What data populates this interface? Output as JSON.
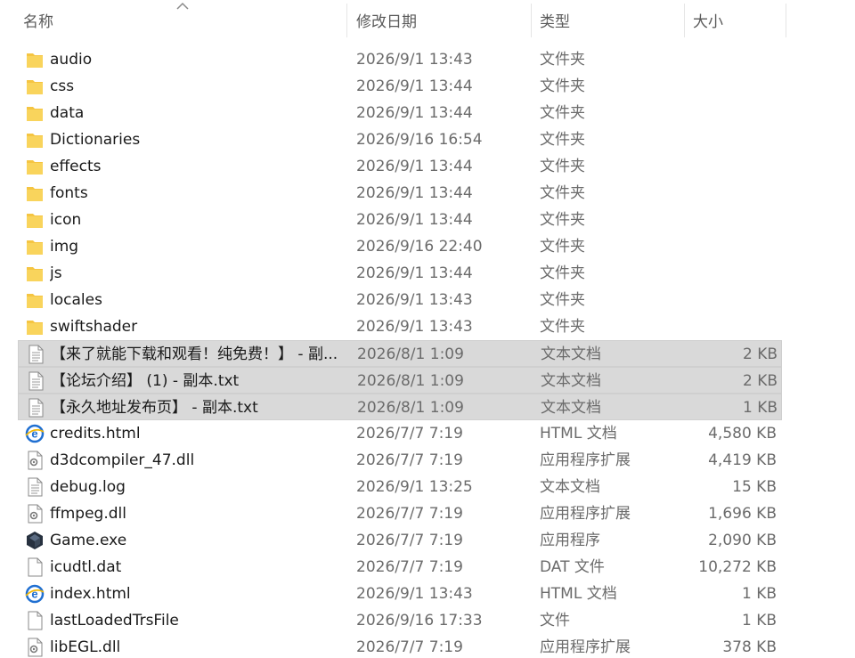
{
  "header": {
    "name": "名称",
    "date": "修改日期",
    "type": "类型",
    "size": "大小"
  },
  "rows": [
    {
      "name": "audio",
      "date": "2026/9/1 13:43",
      "type": "文件夹",
      "size": "",
      "icon": "folder-icon",
      "selected": false
    },
    {
      "name": "css",
      "date": "2026/9/1 13:44",
      "type": "文件夹",
      "size": "",
      "icon": "folder-icon",
      "selected": false
    },
    {
      "name": "data",
      "date": "2026/9/1 13:44",
      "type": "文件夹",
      "size": "",
      "icon": "folder-icon",
      "selected": false
    },
    {
      "name": "Dictionaries",
      "date": "2026/9/16 16:54",
      "type": "文件夹",
      "size": "",
      "icon": "folder-icon",
      "selected": false
    },
    {
      "name": "effects",
      "date": "2026/9/1 13:44",
      "type": "文件夹",
      "size": "",
      "icon": "folder-icon",
      "selected": false
    },
    {
      "name": "fonts",
      "date": "2026/9/1 13:44",
      "type": "文件夹",
      "size": "",
      "icon": "folder-icon",
      "selected": false
    },
    {
      "name": "icon",
      "date": "2026/9/1 13:44",
      "type": "文件夹",
      "size": "",
      "icon": "folder-icon",
      "selected": false
    },
    {
      "name": "img",
      "date": "2026/9/16 22:40",
      "type": "文件夹",
      "size": "",
      "icon": "folder-icon",
      "selected": false
    },
    {
      "name": "js",
      "date": "2026/9/1 13:44",
      "type": "文件夹",
      "size": "",
      "icon": "folder-icon",
      "selected": false
    },
    {
      "name": "locales",
      "date": "2026/9/1 13:43",
      "type": "文件夹",
      "size": "",
      "icon": "folder-icon",
      "selected": false
    },
    {
      "name": "swiftshader",
      "date": "2026/9/1 13:43",
      "type": "文件夹",
      "size": "",
      "icon": "folder-icon",
      "selected": false
    },
    {
      "name": "【来了就能下载和观看！纯免费！】 - 副...",
      "date": "2026/8/1 1:09",
      "type": "文本文档",
      "size": "2 KB",
      "icon": "text-file-icon",
      "selected": true
    },
    {
      "name": "【论坛介绍】 (1) - 副本.txt",
      "date": "2026/8/1 1:09",
      "type": "文本文档",
      "size": "2 KB",
      "icon": "text-file-icon",
      "selected": true
    },
    {
      "name": "【永久地址发布页】 - 副本.txt",
      "date": "2026/8/1 1:09",
      "type": "文本文档",
      "size": "1 KB",
      "icon": "text-file-icon",
      "selected": true
    },
    {
      "name": "credits.html",
      "date": "2026/7/7 7:19",
      "type": "HTML 文档",
      "size": "4,580 KB",
      "icon": "html-file-icon",
      "selected": false
    },
    {
      "name": "d3dcompiler_47.dll",
      "date": "2026/7/7 7:19",
      "type": "应用程序扩展",
      "size": "4,419 KB",
      "icon": "dll-file-icon",
      "selected": false
    },
    {
      "name": "debug.log",
      "date": "2026/9/1 13:25",
      "type": "文本文档",
      "size": "15 KB",
      "icon": "text-file-icon",
      "selected": false
    },
    {
      "name": "ffmpeg.dll",
      "date": "2026/7/7 7:19",
      "type": "应用程序扩展",
      "size": "1,696 KB",
      "icon": "dll-file-icon",
      "selected": false
    },
    {
      "name": "Game.exe",
      "date": "2026/7/7 7:19",
      "type": "应用程序",
      "size": "2,090 KB",
      "icon": "exe-file-icon",
      "selected": false
    },
    {
      "name": "icudtl.dat",
      "date": "2026/7/7 7:19",
      "type": "DAT 文件",
      "size": "10,272 KB",
      "icon": "blank-file-icon",
      "selected": false
    },
    {
      "name": "index.html",
      "date": "2026/9/1 13:43",
      "type": "HTML 文档",
      "size": "1 KB",
      "icon": "html-file-icon",
      "selected": false
    },
    {
      "name": "lastLoadedTrsFile",
      "date": "2026/9/16 17:33",
      "type": "文件",
      "size": "1 KB",
      "icon": "blank-file-icon",
      "selected": false
    },
    {
      "name": "libEGL.dll",
      "date": "2026/7/7 7:19",
      "type": "应用程序扩展",
      "size": "378 KB",
      "icon": "dll-file-icon",
      "selected": false
    }
  ]
}
